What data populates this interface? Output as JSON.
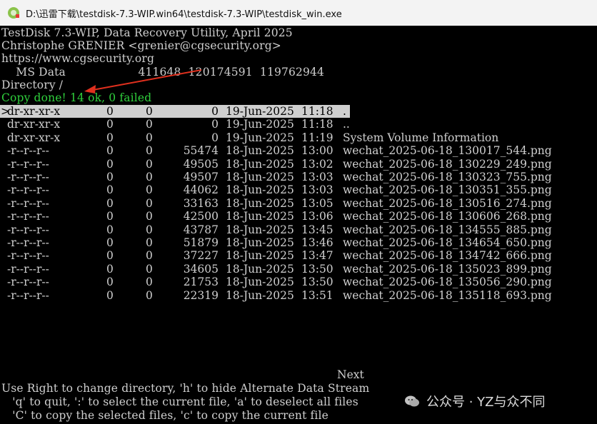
{
  "window": {
    "title": "D:\\迅雷下载\\testdisk-7.3-WIP.win64\\testdisk-7.3-WIP\\testdisk_win.exe"
  },
  "header": {
    "line1": "TestDisk 7.3-WIP, Data Recovery Utility, April 2025",
    "line2": "Christophe GRENIER <grenier@cgsecurity.org>",
    "line3": "https://www.cgsecurity.org",
    "partition": "    MS Data                    411648  120174591  119762944",
    "directory": "Directory /",
    "status": "Copy done! 14 ok, 0 failed"
  },
  "files": [
    {
      "cursor": ">",
      "perm": "dr-xr-xr-x",
      "uid": "0",
      "gid": "0",
      "size": "0",
      "date": "19-Jun-2025",
      "time": "11:18",
      "name": "."
    },
    {
      "cursor": "",
      "perm": "dr-xr-xr-x",
      "uid": "0",
      "gid": "0",
      "size": "0",
      "date": "19-Jun-2025",
      "time": "11:18",
      "name": ".."
    },
    {
      "cursor": "",
      "perm": "dr-xr-xr-x",
      "uid": "0",
      "gid": "0",
      "size": "0",
      "date": "19-Jun-2025",
      "time": "11:19",
      "name": "System Volume Information"
    },
    {
      "cursor": "",
      "perm": "-r--r--r--",
      "uid": "0",
      "gid": "0",
      "size": "55474",
      "date": "18-Jun-2025",
      "time": "13:00",
      "name": "wechat_2025-06-18_130017_544.png"
    },
    {
      "cursor": "",
      "perm": "-r--r--r--",
      "uid": "0",
      "gid": "0",
      "size": "49505",
      "date": "18-Jun-2025",
      "time": "13:02",
      "name": "wechat_2025-06-18_130229_249.png"
    },
    {
      "cursor": "",
      "perm": "-r--r--r--",
      "uid": "0",
      "gid": "0",
      "size": "49507",
      "date": "18-Jun-2025",
      "time": "13:03",
      "name": "wechat_2025-06-18_130323_755.png"
    },
    {
      "cursor": "",
      "perm": "-r--r--r--",
      "uid": "0",
      "gid": "0",
      "size": "44062",
      "date": "18-Jun-2025",
      "time": "13:03",
      "name": "wechat_2025-06-18_130351_355.png"
    },
    {
      "cursor": "",
      "perm": "-r--r--r--",
      "uid": "0",
      "gid": "0",
      "size": "33163",
      "date": "18-Jun-2025",
      "time": "13:05",
      "name": "wechat_2025-06-18_130516_274.png"
    },
    {
      "cursor": "",
      "perm": "-r--r--r--",
      "uid": "0",
      "gid": "0",
      "size": "42500",
      "date": "18-Jun-2025",
      "time": "13:06",
      "name": "wechat_2025-06-18_130606_268.png"
    },
    {
      "cursor": "",
      "perm": "-r--r--r--",
      "uid": "0",
      "gid": "0",
      "size": "43787",
      "date": "18-Jun-2025",
      "time": "13:45",
      "name": "wechat_2025-06-18_134555_885.png"
    },
    {
      "cursor": "",
      "perm": "-r--r--r--",
      "uid": "0",
      "gid": "0",
      "size": "51879",
      "date": "18-Jun-2025",
      "time": "13:46",
      "name": "wechat_2025-06-18_134654_650.png"
    },
    {
      "cursor": "",
      "perm": "-r--r--r--",
      "uid": "0",
      "gid": "0",
      "size": "37227",
      "date": "18-Jun-2025",
      "time": "13:47",
      "name": "wechat_2025-06-18_134742_666.png"
    },
    {
      "cursor": "",
      "perm": "-r--r--r--",
      "uid": "0",
      "gid": "0",
      "size": "34605",
      "date": "18-Jun-2025",
      "time": "13:50",
      "name": "wechat_2025-06-18_135023_899.png"
    },
    {
      "cursor": "",
      "perm": "-r--r--r--",
      "uid": "0",
      "gid": "0",
      "size": "21753",
      "date": "18-Jun-2025",
      "time": "13:50",
      "name": "wechat_2025-06-18_135056_290.png"
    },
    {
      "cursor": "",
      "perm": "-r--r--r--",
      "uid": "0",
      "gid": "0",
      "size": "22319",
      "date": "18-Jun-2025",
      "time": "13:51",
      "name": "wechat_2025-06-18_135118_693.png"
    }
  ],
  "footer": {
    "next": "Next",
    "help1": "Use Right to change directory, 'h' to hide Alternate Data Stream",
    "help2": "   'q' to quit, ':' to select the current file, 'a' to deselect all files",
    "help3": "   'C' to copy the selected files, 'c' to copy the current file"
  },
  "watermark": {
    "text": "公众号 · YZ与众不同"
  },
  "colors": {
    "status_green": "#2fcf3c",
    "annotation_arrow": "#e0301e",
    "selection_bg": "#cfcfcf"
  }
}
